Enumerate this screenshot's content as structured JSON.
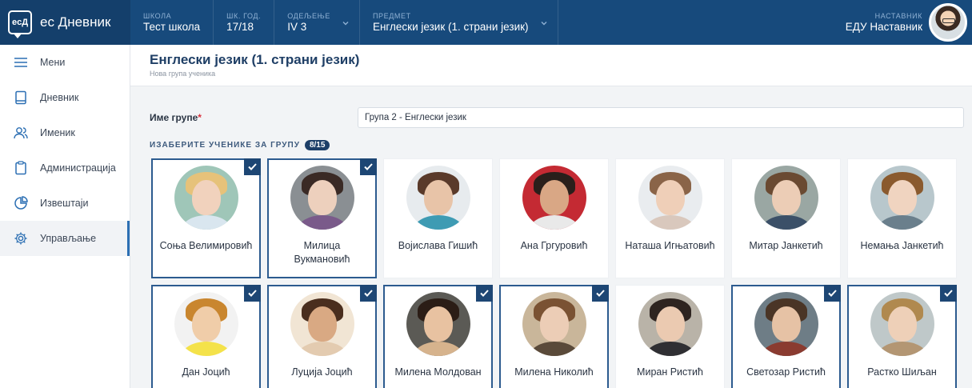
{
  "topbar": {
    "brand": "ес Дневник",
    "logo_text": "eсД",
    "school_label": "ШКОЛА",
    "school_value": "Тест школа",
    "year_label": "ШК. ГОД.",
    "year_value": "17/18",
    "class_label": "ОДЕЉЕЊЕ",
    "class_value": "IV 3",
    "subject_label": "ПРЕДМЕТ",
    "subject_value": "Енглески језик (1. страни језик)",
    "teacher_label": "НАСТАВНИК",
    "teacher_value": "ЕДУ Наставник"
  },
  "sidebar": {
    "items": [
      {
        "label": "Мени",
        "icon": "menu-icon"
      },
      {
        "label": "Дневник",
        "icon": "book-icon"
      },
      {
        "label": "Именик",
        "icon": "people-icon"
      },
      {
        "label": "Администрација",
        "icon": "clipboard-icon"
      },
      {
        "label": "Извештаји",
        "icon": "pie-chart-icon"
      },
      {
        "label": "Управљање",
        "icon": "gear-icon"
      }
    ]
  },
  "page": {
    "title": "Енглески језик (1. страни језик)",
    "subtitle": "Нова група ученика"
  },
  "form": {
    "group_name_label": "Име групе",
    "required_mark": "*",
    "group_name_value": "Група 2 - Енглески језик"
  },
  "picker": {
    "label": "ИЗАБЕРИТЕ УЧЕНИКЕ ЗА ГРУПУ",
    "count": "8/15"
  },
  "students": [
    {
      "name": "Соња Велимировић",
      "selected": true,
      "bg": "#9fc6b8",
      "skin": "#f1d2bd",
      "hair": "#e6c27a",
      "shirt": "#d9e6ef"
    },
    {
      "name": "Милица Вукмановић",
      "selected": true,
      "bg": "#8a8f93",
      "skin": "#edd0bd",
      "hair": "#3a2a25",
      "shirt": "#7a5a8a"
    },
    {
      "name": "Војислава Гишић",
      "selected": false,
      "bg": "#e7ebee",
      "skin": "#e8c4a8",
      "hair": "#5a3a2a",
      "shirt": "#3e9bb3"
    },
    {
      "name": "Ана Гргуровић",
      "selected": false,
      "bg": "#c42a33",
      "skin": "#d9a785",
      "hair": "#2a1f1b",
      "shirt": "#e9e9e9"
    },
    {
      "name": "Наташа Игњатовић",
      "selected": false,
      "bg": "#e9ecef",
      "skin": "#efcfb8",
      "hair": "#8a6448",
      "shirt": "#d9c8bd"
    },
    {
      "name": "Митар Јанкетић",
      "selected": false,
      "bg": "#9aa7a3",
      "skin": "#eccdb6",
      "hair": "#6a4a32",
      "shirt": "#3b5068"
    },
    {
      "name": "Немања Јанкетић",
      "selected": false,
      "bg": "#b8c7cc",
      "skin": "#f0d4c0",
      "hair": "#8a5a2e",
      "shirt": "#6a7f8c"
    },
    {
      "name": "Дан Јоцић",
      "selected": true,
      "bg": "#f2f2f2",
      "skin": "#f0cda9",
      "hair": "#c9862f",
      "shirt": "#f4e24a"
    },
    {
      "name": "Луција Јоцић",
      "selected": true,
      "bg": "#f1e5d4",
      "skin": "#d9a983",
      "hair": "#4a2e1e",
      "shirt": "#e3cbb0"
    },
    {
      "name": "Милена Молдован",
      "selected": true,
      "bg": "#5b5a55",
      "skin": "#e8c2a1",
      "hair": "#2b1d16",
      "shirt": "#d6b38d"
    },
    {
      "name": "Милена Николић",
      "selected": true,
      "bg": "#c9b69a",
      "skin": "#eccdb6",
      "hair": "#7a5233",
      "shirt": "#5a4a3a"
    },
    {
      "name": "Миран Ристић",
      "selected": false,
      "bg": "#b9b3a8",
      "skin": "#ebcab1",
      "hair": "#2e2420",
      "shirt": "#2f2f33"
    },
    {
      "name": "Светозар Ристић",
      "selected": true,
      "bg": "#6e7d86",
      "skin": "#e6c2a5",
      "hair": "#4a3526",
      "shirt": "#8a3b30"
    },
    {
      "name": "Растко Шиљан",
      "selected": true,
      "bg": "#bfc8c9",
      "skin": "#eed0b8",
      "hair": "#b0894f",
      "shirt": "#b39673"
    }
  ]
}
